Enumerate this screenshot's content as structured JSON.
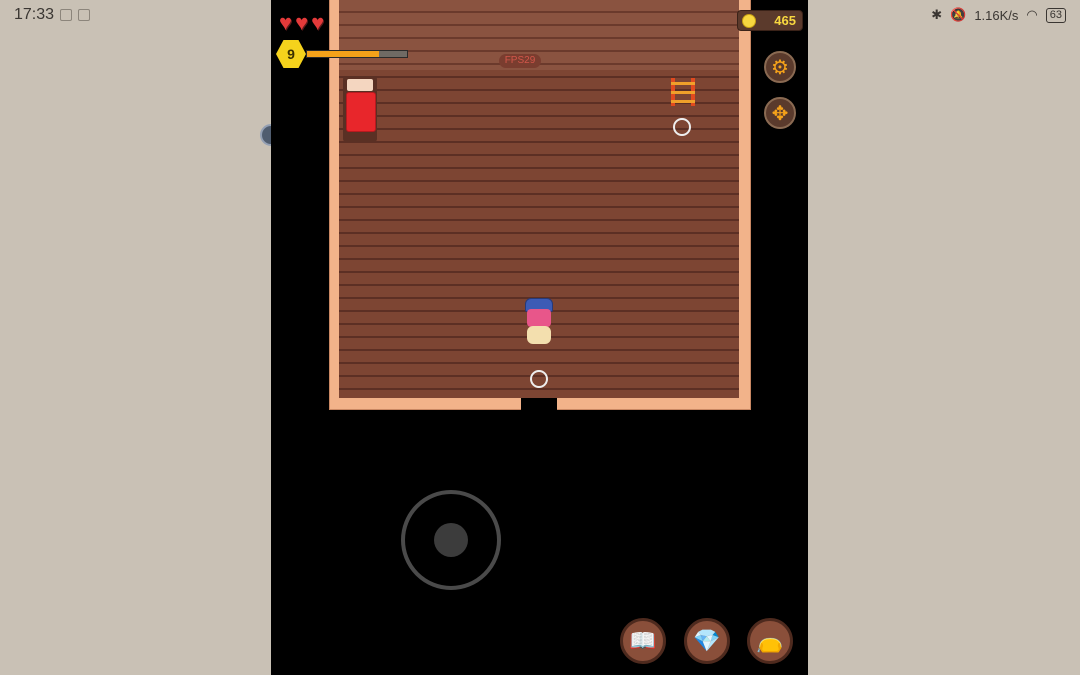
{
  "status_bar": {
    "time": "17:33",
    "network_speed": "1.16K/s",
    "battery": "63"
  },
  "hud": {
    "hearts": [
      "♥",
      "♥",
      "♥"
    ],
    "level": "9",
    "xp_fraction": 0.72,
    "fps_label": "FPS29",
    "coins": "465"
  },
  "icons": {
    "settings": "gear-icon",
    "move": "move-arrows-icon",
    "journal": "book-icon",
    "shop": "gem-icon",
    "bag": "leather-bag-icon"
  },
  "colors": {
    "heart": "#e43a3a",
    "coin": "#f8d840",
    "xp": "#f5a21a",
    "level": "#f5d21c"
  }
}
